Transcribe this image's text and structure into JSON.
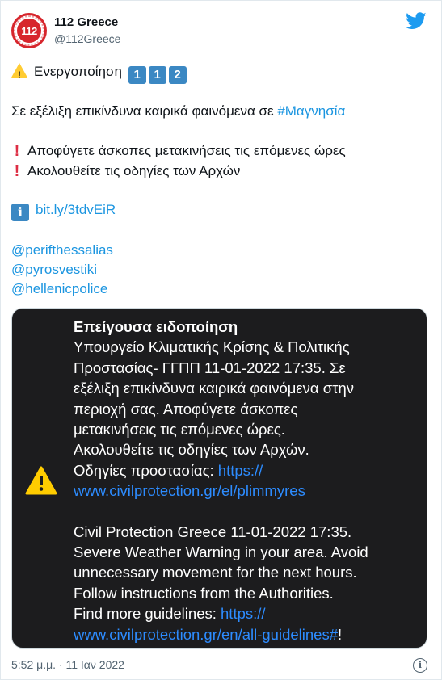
{
  "account": {
    "name": "112 Greece",
    "handle": "@112Greece",
    "avatar_text": "112"
  },
  "tweet": {
    "line1_text": "Ενεργοποίηση",
    "keycaps": [
      "1",
      "1",
      "2"
    ],
    "line2_text": "Σε εξέλιξη επικίνδυνα καιρικά φαινόμενα σε ",
    "line2_hashtag": "#Μαγνησία",
    "line3_text": "Αποφύγετε άσκοπες μετακινήσεις τις επόμενες ώρες",
    "line4_text": "Ακολουθείτε τις οδηγίες των Αρχών",
    "info_symbol": "i",
    "short_link": "bit.ly/3tdvEiR",
    "mentions": [
      "@perifthessalias",
      "@pyrosvestiki",
      "@hellenicpolice"
    ]
  },
  "alert": {
    "title": "Επείγουσα ειδοποίηση",
    "greek_lines": [
      "Υπουργείο Κλιματικής Κρίσης & Πολιτικής",
      "Προστασίας- ΓΓΠΠ 11-01-2022 17:35. Σε",
      "εξέλιξη επικίνδυνα καιρικά φαινόμενα στην",
      "περιοχή σας. Αποφύγετε άσκοπες",
      "μετακινήσεις τις επόμενες ώρες.",
      "Ακολουθείτε τις οδηγίες των Αρχών."
    ],
    "greek_link_prefix": "Οδηγίες προστασίας: ",
    "greek_link_part1": "https://",
    "greek_link_part2": "www.civilprotection.gr/el/plimmyres",
    "english_lines": [
      "Civil Protection Greece 11-01-2022 17:35.",
      "Severe Weather Warning in your area. Avoid",
      "unnecessary movement for the next hours.",
      "Follow instructions from the Authorities."
    ],
    "english_link_prefix": "Find more guidelines: ",
    "english_link_part1": "https://",
    "english_link_part2": "www.civilprotection.gr/en/all-guidelines#",
    "english_link_suffix": "!"
  },
  "footer": {
    "timestamp": "5:52 μ.μ. · 11 Ιαν 2022",
    "info_symbol": "i"
  },
  "colors": {
    "link": "#1b95e0",
    "alert_bg": "#1c1c1e",
    "alert_link": "#2d8cff",
    "brand_red": "#d7262d",
    "twitter_blue": "#1d9bf0"
  },
  "icons": [
    "avatar-112-logo",
    "twitter-bird-icon",
    "warning-emoji-icon",
    "keycap-digit-icon",
    "red-exclamation-icon",
    "information-emoji-icon",
    "alert-warning-triangle-icon",
    "info-circle-icon"
  ]
}
